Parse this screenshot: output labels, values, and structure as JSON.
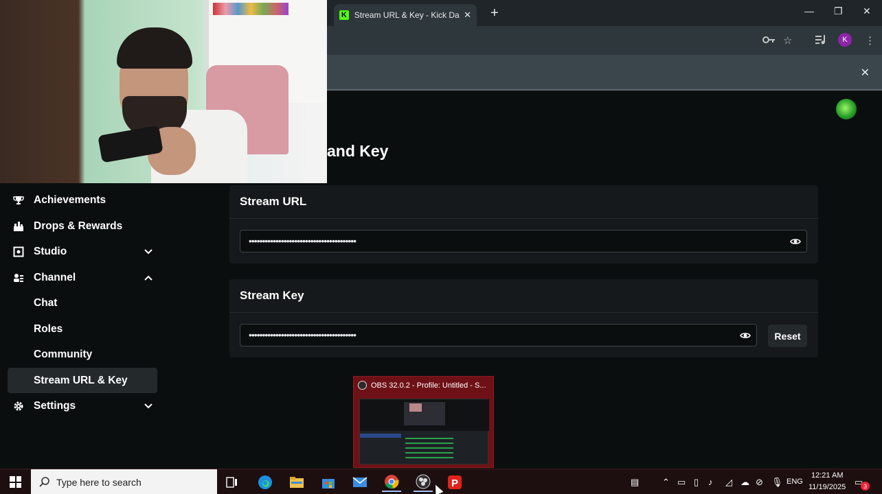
{
  "browser": {
    "tab_title": "Stream URL & Key - Kick Dashb",
    "tab_favicon_letter": "K",
    "profile_letter": "K",
    "icons": [
      "key-icon",
      "star-icon",
      "media-control-icon",
      "kebab-menu-icon"
    ]
  },
  "page": {
    "title_partial": "and Key"
  },
  "sidebar": {
    "items": [
      {
        "label": "Achievements",
        "icon": "trophy-icon"
      },
      {
        "label": "Drops & Rewards",
        "icon": "gift-icon"
      },
      {
        "label": "Studio",
        "icon": "studio-icon",
        "expanded": false
      },
      {
        "label": "Channel",
        "icon": "channel-icon",
        "expanded": true
      },
      {
        "label": "Chat"
      },
      {
        "label": "Roles"
      },
      {
        "label": "Community"
      },
      {
        "label": "Stream URL & Key",
        "selected": true
      },
      {
        "label": "Settings",
        "icon": "gear-icon",
        "expanded": false
      }
    ]
  },
  "stream_url": {
    "title": "Stream URL",
    "masked_value": "••••••••••••••••••••••••••••••••••••••••"
  },
  "stream_key": {
    "title": "Stream Key",
    "masked_value": "••••••••••••••••••••••••••••••••••••••••",
    "reset_label": "Reset"
  },
  "obs_preview": {
    "title": "OBS 32.0.2 - Profile: Untitled - S..."
  },
  "taskbar": {
    "search_placeholder": "Type here to search",
    "language": "ENG",
    "time": "12:21 AM",
    "date": "11/19/2025",
    "notification_count": "3"
  },
  "colors": {
    "page_bg": "#0b0e0f",
    "card_bg": "#15191b",
    "kick_green": "#53fc18",
    "taskbar_bg": "#1d0f0f"
  }
}
